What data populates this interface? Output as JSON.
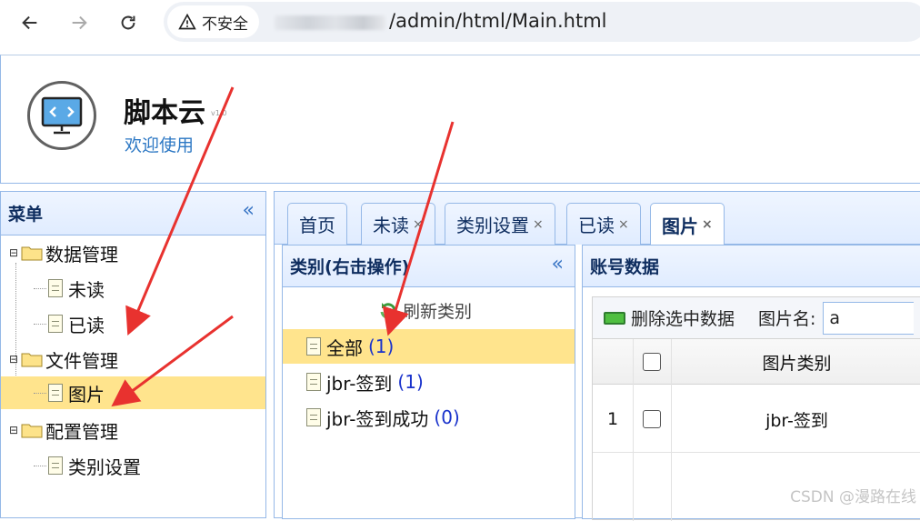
{
  "browser": {
    "security_label": "不安全",
    "url_path": "/admin/html/Main.html"
  },
  "header": {
    "title": "脚本云",
    "version": "v1.0",
    "welcome": "欢迎使用"
  },
  "menu": {
    "title": "菜单",
    "collapse_glyph": "«",
    "items": [
      {
        "label": "数据管理",
        "type": "folder"
      },
      {
        "label": "未读",
        "type": "leaf"
      },
      {
        "label": "已读",
        "type": "leaf"
      },
      {
        "label": "文件管理",
        "type": "folder"
      },
      {
        "label": "图片",
        "type": "leaf",
        "selected": true
      },
      {
        "label": "配置管理",
        "type": "folder"
      },
      {
        "label": "类别设置",
        "type": "leaf"
      }
    ]
  },
  "tabs": [
    {
      "label": "首页",
      "closable": false
    },
    {
      "label": "未读",
      "closable": true
    },
    {
      "label": "类别设置",
      "closable": true
    },
    {
      "label": "已读",
      "closable": true
    },
    {
      "label": "图片",
      "closable": true,
      "active": true
    }
  ],
  "tab_close_glyph": "×",
  "category_panel": {
    "title": "类别(右击操作)",
    "collapse_glyph": "«",
    "refresh_label": "刷新类别",
    "items": [
      {
        "label": "全部",
        "count": "(1)",
        "selected": true
      },
      {
        "label": "jbr-签到",
        "count": "(1)"
      },
      {
        "label": "jbr-签到成功",
        "count": "(0)"
      }
    ]
  },
  "account_panel": {
    "title": "账号数据",
    "delete_button": "删除选中数据",
    "filter_label": "图片名:",
    "filter_value": "a",
    "columns": [
      "图片类别"
    ],
    "rows": [
      {
        "index": "1",
        "category": "jbr-签到"
      }
    ]
  },
  "watermark": "CSDN @漫路在线",
  "colors": {
    "selection": "#ffe48d",
    "panel_border": "#95b8e7",
    "count_blue": "#1a33cc",
    "link_blue": "#2d78c4",
    "annotation_red": "#e8322f"
  },
  "icons": [
    "back-arrow-icon",
    "forward-arrow-icon",
    "reload-icon",
    "warning-icon",
    "monitor-code-icon",
    "folder-icon",
    "document-icon",
    "refresh-icon",
    "delete-icon"
  ]
}
